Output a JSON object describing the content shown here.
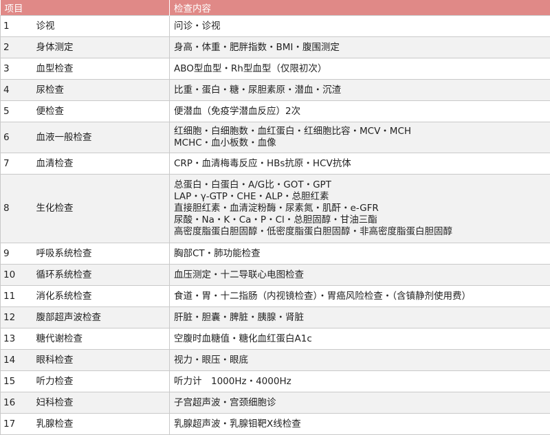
{
  "table": {
    "headers": {
      "item": "项目",
      "content": "检查内容"
    },
    "rows": [
      {
        "no": "1",
        "item": "诊视",
        "content": [
          "问诊・诊视"
        ]
      },
      {
        "no": "2",
        "item": "身体测定",
        "content": [
          "身高・体重・肥胖指数・BMI・腹围测定"
        ]
      },
      {
        "no": "3",
        "item": "血型检查",
        "content": [
          "ABO型血型・Rh型血型（仅限初次）"
        ]
      },
      {
        "no": "4",
        "item": "尿检查",
        "content": [
          "比重・蛋白・糖・尿胆素原・潜血・沉渣"
        ]
      },
      {
        "no": "5",
        "item": "便检查",
        "content": [
          "便潜血（免疫学潜血反应）2次"
        ]
      },
      {
        "no": "6",
        "item": "血液一般检查",
        "content": [
          "红细胞・白细胞数・血红蛋白・红细胞比容・MCV・MCH",
          "MCHC・血小板数・血像"
        ]
      },
      {
        "no": "7",
        "item": "血清检查",
        "content": [
          "CRP・血清梅毒反应・HBs抗原・HCV抗体"
        ]
      },
      {
        "no": "8",
        "item": "生化检查",
        "content": [
          "总蛋白・白蛋白・A/G比・GOT・GPT",
          "LAP・γ-GTP・CHE・ALP・总胆红素",
          "直接胆红素・血清淀粉酶・尿素氮・肌酐・e-GFR",
          "尿酸・Na・K・Ca・P・Cl・总胆固醇・甘油三酯",
          "高密度脂蛋白胆固醇・低密度脂蛋白胆固醇・非高密度脂蛋白胆固醇"
        ]
      },
      {
        "no": "9",
        "item": "呼吸系统检查",
        "content": [
          "胸部CT・肺功能检查"
        ]
      },
      {
        "no": "10",
        "item": "循环系统检查",
        "content": [
          "血压测定・十二导联心电图检查"
        ]
      },
      {
        "no": "11",
        "item": "消化系统检查",
        "content": [
          "食道・胃・十二指肠（内视镜检查）・胃癌风险检查・（含镇静剂使用费）"
        ]
      },
      {
        "no": "12",
        "item": "腹部超声波检查",
        "content": [
          "肝脏・胆囊・脾脏・胰腺・肾脏"
        ]
      },
      {
        "no": "13",
        "item": "糖代谢检查",
        "content": [
          "空腹时血糖值・糖化血红蛋白A1c"
        ]
      },
      {
        "no": "14",
        "item": "眼科检查",
        "content": [
          "视力・眼压・眼底"
        ]
      },
      {
        "no": "15",
        "item": "听力检查",
        "content": [
          "听力计　1000Hz・4000Hz"
        ]
      },
      {
        "no": "16",
        "item": "妇科检查",
        "content": [
          "子宫超声波・宫颈细胞诊"
        ]
      },
      {
        "no": "17",
        "item": "乳腺检查",
        "content": [
          "乳腺超声波・乳腺钼靶X线检查"
        ]
      }
    ]
  },
  "colors": {
    "header_bg": "#e08987",
    "header_text": "#ffffff",
    "row_alt": "#f2f2f2",
    "border": "#c9c9c9"
  }
}
